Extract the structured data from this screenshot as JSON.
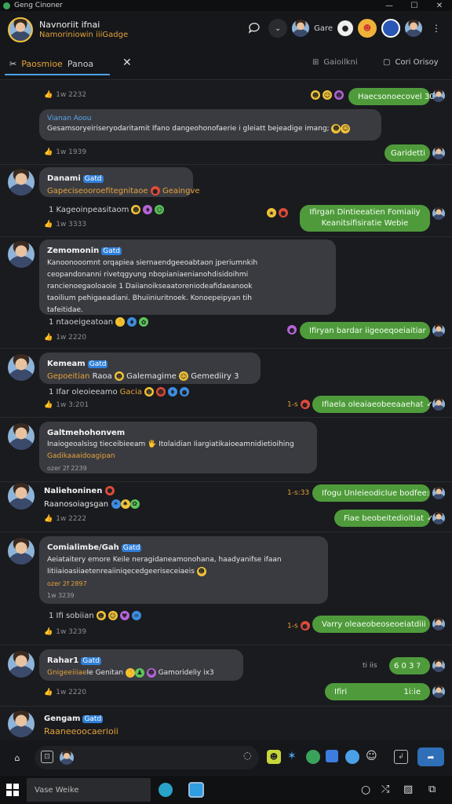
{
  "window": {
    "title": "Geng Cinoner",
    "controls": [
      "—",
      "☐",
      "✕"
    ]
  },
  "header": {
    "name": "Navnoriit ifnai",
    "subtitle": "Namoriniowin iiiGadge",
    "gray_label": "Gare"
  },
  "tabs": {
    "active": "Paosmioe",
    "active2": "Panoa",
    "right1": "Gaioilkni",
    "right2": "Cori Orisoy"
  },
  "messages": [
    {
      "id": "m0",
      "meta": "1w 2232",
      "outgoing": "Haecsonoecovel 30"
    },
    {
      "id": "m1",
      "sender": "Vianan Aoou",
      "text": "Gesamsoryeiriseryodaritamit Ifano dangeohonofaerie i gleiatt bejeadige imang;",
      "meta": "1w 1939",
      "outgoing": "Garidetti"
    },
    {
      "id": "m2",
      "sender": "Danami",
      "badge": "Gatd",
      "sub": "Gapeciseooroefitegnitaoe",
      "sub2": "Geaingve",
      "reactions": "1 Kageoinpeasitaom",
      "meta": "1w 3333",
      "outgoing1": "Ifirgan Dintieeatien Fomiaiiy",
      "outgoing2": "Keanitsifisiratie",
      "outgoing3": "Webie"
    },
    {
      "id": "m3",
      "sender": "Zemomonin",
      "badge": "Gatd",
      "lines": [
        "Kanoonooomnt orqapiea siernaendgeeoabtaon jperiumnkih",
        "ceopandonanni rivetqgyung nbopianiaenianohdisidoihmi",
        "rancienoegaoloaoie 1 Daiianoikseaatoreniodeafidaeanook",
        "taoilium pehigaeadiani. Bhuiiniuritnoek. Konoepeipyan tih",
        "tafeitidae."
      ],
      "reactions": "1 ntaoeigeatoan",
      "meta": "1w 2220",
      "outgoing": "Ifiryan bardar iigeoeqoeiaitiar"
    },
    {
      "id": "m4",
      "sender": "Kemeam",
      "badge": "Gatd",
      "sub": "Gepoeitian",
      "sub_tail": "Raoa",
      "mid": "Galemagime",
      "end": "Gemediiry 3",
      "reactions": "1 Ifar oleoieeamo",
      "tag": "Gacia",
      "meta": "1w 3:201",
      "tick": "1-s",
      "outgoing": "Ifiaela oleaiaeobeeaaehat"
    },
    {
      "id": "m5",
      "sender": "Galtmehohonvem",
      "text": "Inaiogeoalsisg tieceibieeam",
      "tail": "Itolaidian Iiargiatikaioeamnidietioihing",
      "sub": "Gadikaaaidoagipan",
      "meta2": "ozer 2f 2239"
    },
    {
      "id": "m6",
      "sender": "Naliehoninen",
      "sub": "Raanosoiagsgan",
      "tick": "1-s:33",
      "outgoing1": "Ifogu Unleieodiclue bodfee:",
      "outgoing2": "Fiae beobeitedioitiat",
      "meta": "1w 2222"
    },
    {
      "id": "m7",
      "sender": "Comialimbe/Gah",
      "badge": "Gatd",
      "lines": [
        "Aeiataitery emore Keile neragidaneamonohana, haadyanifse ifaan",
        "Iitiiaioasiiaetenreaiiniqecedgeeriseceiaeis"
      ],
      "sub": "ozer 2f 2897",
      "sub2": "1w 3239",
      "reactions": "1 Ifi sobiian",
      "tick": "1-s",
      "outgoing": "Varry oleaeobeoseoeiatdiii"
    },
    {
      "id": "m8",
      "sender": "Rahar1",
      "badge": "Gatd",
      "sub": "Gnigeeiiiae",
      "mid": "Ie Genitan",
      "end": "Gamorideliy ix3",
      "tick2": "ti iis",
      "meta": "1w 2220",
      "outgoing": "Ifiri",
      "outgoing_time": "1i:ie",
      "outgoing_pill": "6 0 3 ?"
    },
    {
      "id": "m9",
      "sender": "Gengam",
      "badge": "Gatd",
      "sub": "Raaneeoocaerioii"
    }
  ],
  "taskbar": {
    "search": "Vase Weike"
  },
  "colors": {
    "bg": "#1a1b1e",
    "bubble_in": "#3a3b40",
    "bubble_out": "#4f9b3c",
    "accent": "#e5a23b",
    "badge": "#2f7fd9"
  }
}
